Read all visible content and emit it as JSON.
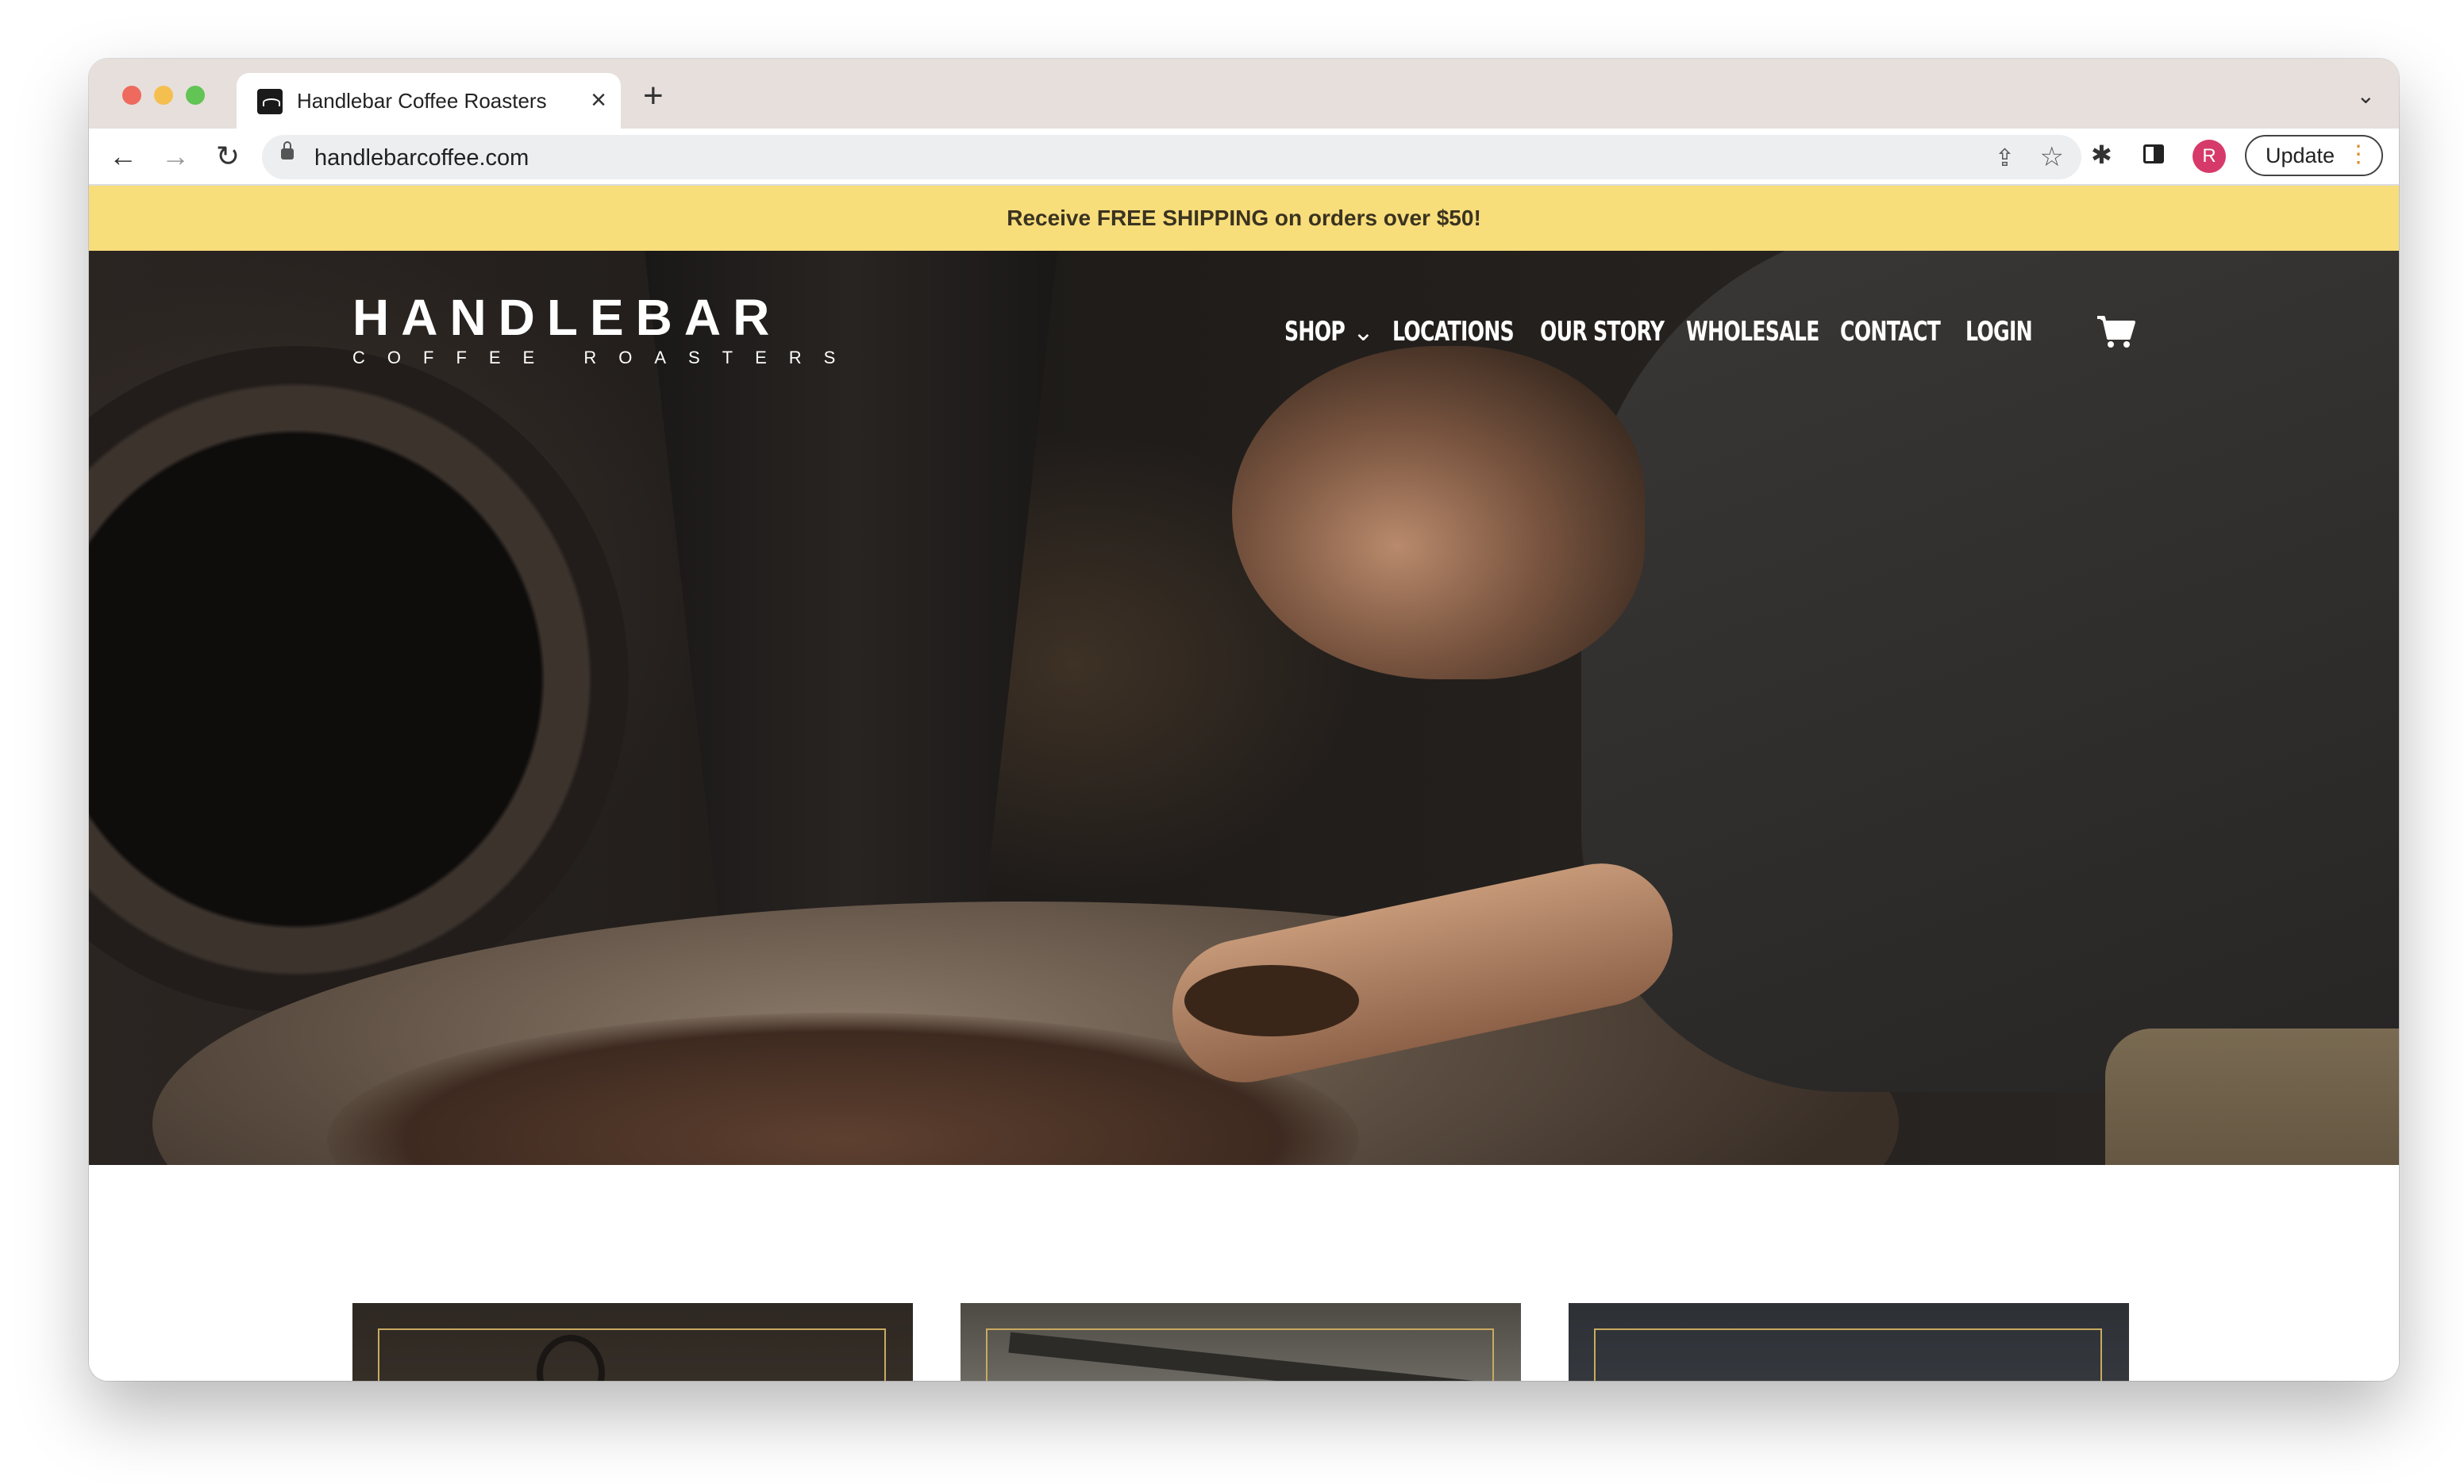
{
  "browser": {
    "tab_title": "Handlebar Coffee Roasters",
    "tab_close": "×",
    "new_tab": "+",
    "tabs_menu": "⌄",
    "url": "handlebarcoffee.com",
    "profile_initial": "R",
    "update_label": "Update",
    "update_dots": "⋮"
  },
  "icons": {
    "back": "←",
    "forward": "→",
    "reload": "↻",
    "share": "⇪",
    "star": "☆",
    "extensions": "✱",
    "chevron": "⌄"
  },
  "promo": {
    "text": "Receive FREE SHIPPING on orders over $50!"
  },
  "logo": {
    "main": "HANDLEBAR",
    "sub": "COFFEE ROASTERS"
  },
  "nav": {
    "shop": "SHOP",
    "locations": "LOCATIONS",
    "our_story": "OUR STORY",
    "wholesale": "WHOLESALE",
    "contact": "CONTACT",
    "login": "LOGIN"
  },
  "colors": {
    "promo_bg": "#f8dd7b",
    "card_frame": "#c9ab5f",
    "profile": "#d63a6a"
  }
}
